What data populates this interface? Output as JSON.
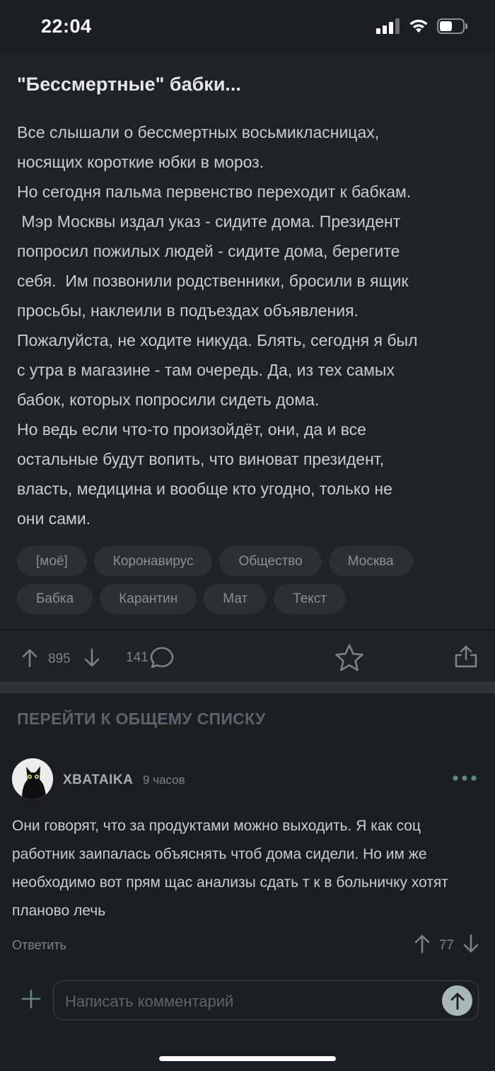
{
  "status": {
    "time": "22:04"
  },
  "post": {
    "title": "\"Бессмертные\" бабки...",
    "body": [
      "Все слышали о бессмертных восьмикласницах,\nносящих короткие юбки в мороз.",
      "Но сегодня пальма первенство переходит к бабкам.\n Мэр Москвы издал указ - сидите дома. Президент\nпопросил пожилых людей - сидите дома, берегите\nсебя.  Им позвонили родственники, бросили в ящик\nпросьбы, наклеили в подъездах объявления.\nПожалуйста, не ходите никуда. Блять, сегодня я был\nс утра в магазине - там очередь. Да, из тех самых\nбабок, которых попросили сидеть дома.",
      "Но ведь если что-то произойдёт, они, да и все\nостальные будут вопить, что виноват президент,\nвласть, медицина и вообще кто угодно, только не\nони сами."
    ],
    "tags": [
      "[моё]",
      "Коронавирус",
      "Общество",
      "Москва",
      "Бабка",
      "Карантин",
      "Мат",
      "Текст"
    ],
    "rating": "895",
    "comments_count": "141"
  },
  "goto_label": "ПЕРЕЙТИ К ОБЩЕМУ СПИСКУ",
  "comment": {
    "user": "XBATAIKA",
    "time": "9 часов",
    "text": "Они говорят, что за продуктами можно выходить. Я как соц работник заипалась объяснять чтоб дома сидели. Но им же необходимо вот прям щас анализы сдать т к в больничку хотят планово лечь",
    "reply_label": "Ответить",
    "rating": "77"
  },
  "composer": {
    "placeholder": "Написать комментарий"
  },
  "colors": {
    "background": "#1b1e22",
    "accent": "#a7b8b6",
    "dots": "#5c8a86"
  }
}
